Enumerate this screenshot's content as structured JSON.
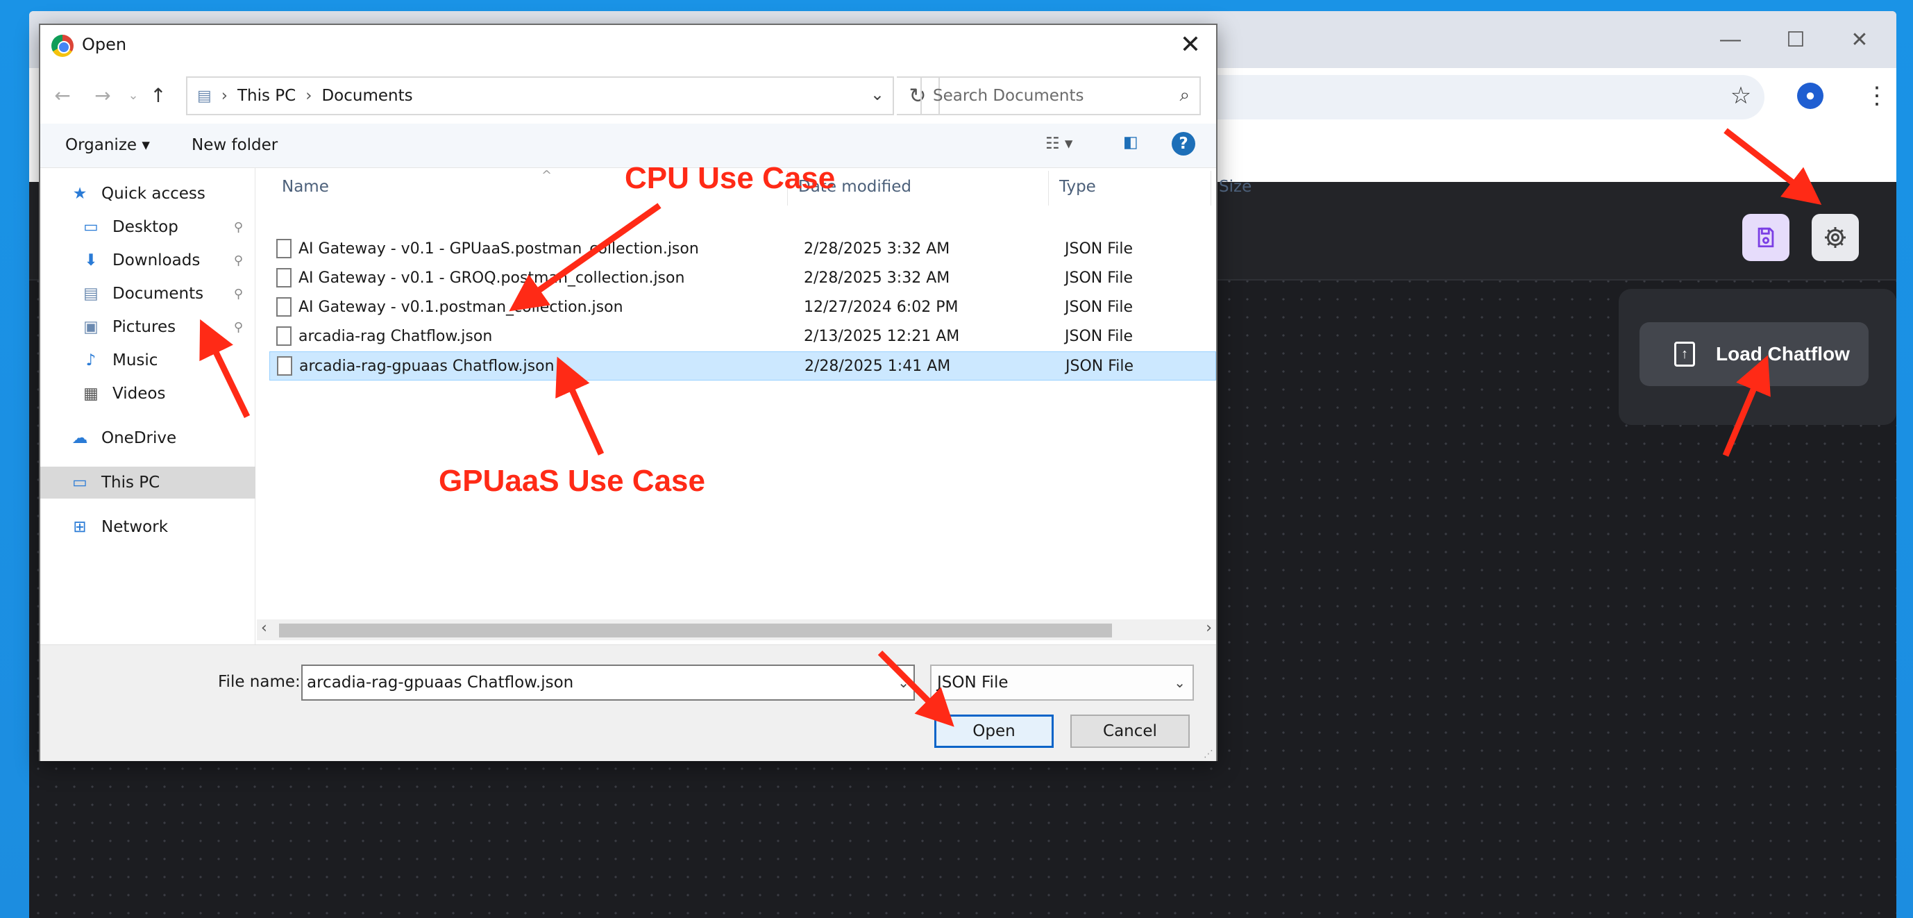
{
  "browser": {
    "window_controls": {
      "minimize": "—",
      "maximize": "☐",
      "close": "✕"
    },
    "icons": [
      "star-icon",
      "profile-icon",
      "menu-icon"
    ]
  },
  "app": {
    "menu": {
      "load_chatflow_label": "Load Chatflow"
    },
    "icons": [
      "save-icon",
      "gear-icon",
      "upload-file-icon"
    ]
  },
  "dialog": {
    "title": "Open",
    "breadcrumb": [
      "This PC",
      "Documents"
    ],
    "search_placeholder": "Search Documents",
    "commands": {
      "organize": "Organize ▾",
      "new_folder": "New folder"
    },
    "sidebar": [
      {
        "label": "Quick access",
        "icon": "star-icon",
        "pinned": false
      },
      {
        "label": "Desktop",
        "icon": "desktop-icon",
        "pinned": true
      },
      {
        "label": "Downloads",
        "icon": "download-arrow-icon",
        "pinned": true
      },
      {
        "label": "Documents",
        "icon": "documents-icon",
        "pinned": true
      },
      {
        "label": "Pictures",
        "icon": "pictures-icon",
        "pinned": true
      },
      {
        "label": "Music",
        "icon": "music-note-icon",
        "pinned": false
      },
      {
        "label": "Videos",
        "icon": "videos-icon",
        "pinned": false
      },
      {
        "label": "OneDrive",
        "icon": "cloud-icon",
        "pinned": false
      },
      {
        "label": "This PC",
        "icon": "computer-icon",
        "pinned": false,
        "selected": true
      },
      {
        "label": "Network",
        "icon": "network-icon",
        "pinned": false
      }
    ],
    "columns": [
      "Name",
      "Date modified",
      "Type",
      "Size"
    ],
    "files": [
      {
        "name": "AI Gateway - v0.1 - GPUaaS.postman_collection.json",
        "date": "2/28/2025 3:32 AM",
        "type": "JSON File"
      },
      {
        "name": "AI Gateway - v0.1 - GROQ.postman_collection.json",
        "date": "2/28/2025 3:32 AM",
        "type": "JSON File"
      },
      {
        "name": "AI Gateway - v0.1.postman_collection.json",
        "date": "12/27/2024 6:02 PM",
        "type": "JSON File"
      },
      {
        "name": "arcadia-rag Chatflow.json",
        "date": "2/13/2025 12:21 AM",
        "type": "JSON File"
      },
      {
        "name": "arcadia-rag-gpuaas Chatflow.json",
        "date": "2/28/2025 1:41 AM",
        "type": "JSON File",
        "selected": true
      }
    ],
    "file_name_label": "File name:",
    "file_name_value": "arcadia-rag-gpuaas Chatflow.json",
    "file_type_value": "JSON File",
    "open_label": "Open",
    "cancel_label": "Cancel"
  },
  "annotations": {
    "cpu": "CPU Use Case",
    "gpu": "GPUaaS Use Case",
    "color": "#ff2a16"
  }
}
